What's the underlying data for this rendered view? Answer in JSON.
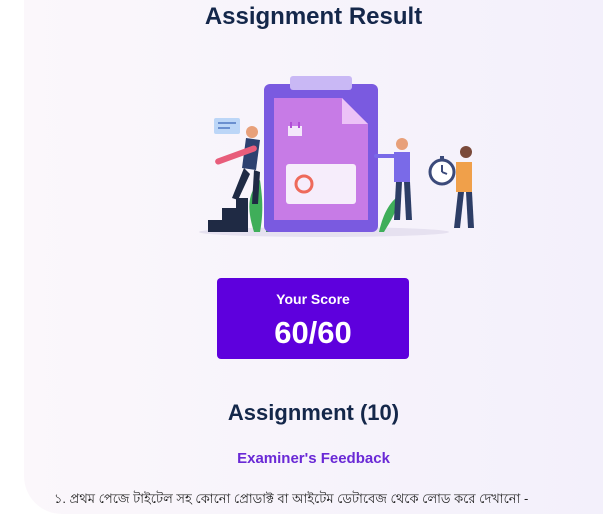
{
  "header": {
    "title": "Assignment Result"
  },
  "illustration": {
    "icon": "assignment-illustration"
  },
  "score": {
    "label": "Your Score",
    "value": "60/60"
  },
  "assignment": {
    "heading": "Assignment (10)"
  },
  "feedback": {
    "label": "Examiner's Feedback",
    "text": "১. প্রথম পেজে টাইটেল সহ কোনো প্রোডাক্ট বা আইটেম ডেটাবেজ থেকে লোড করে দেখানো -"
  },
  "colors": {
    "accent": "#5e00dd",
    "heading": "#14274a",
    "feedback": "#6a29d6"
  }
}
